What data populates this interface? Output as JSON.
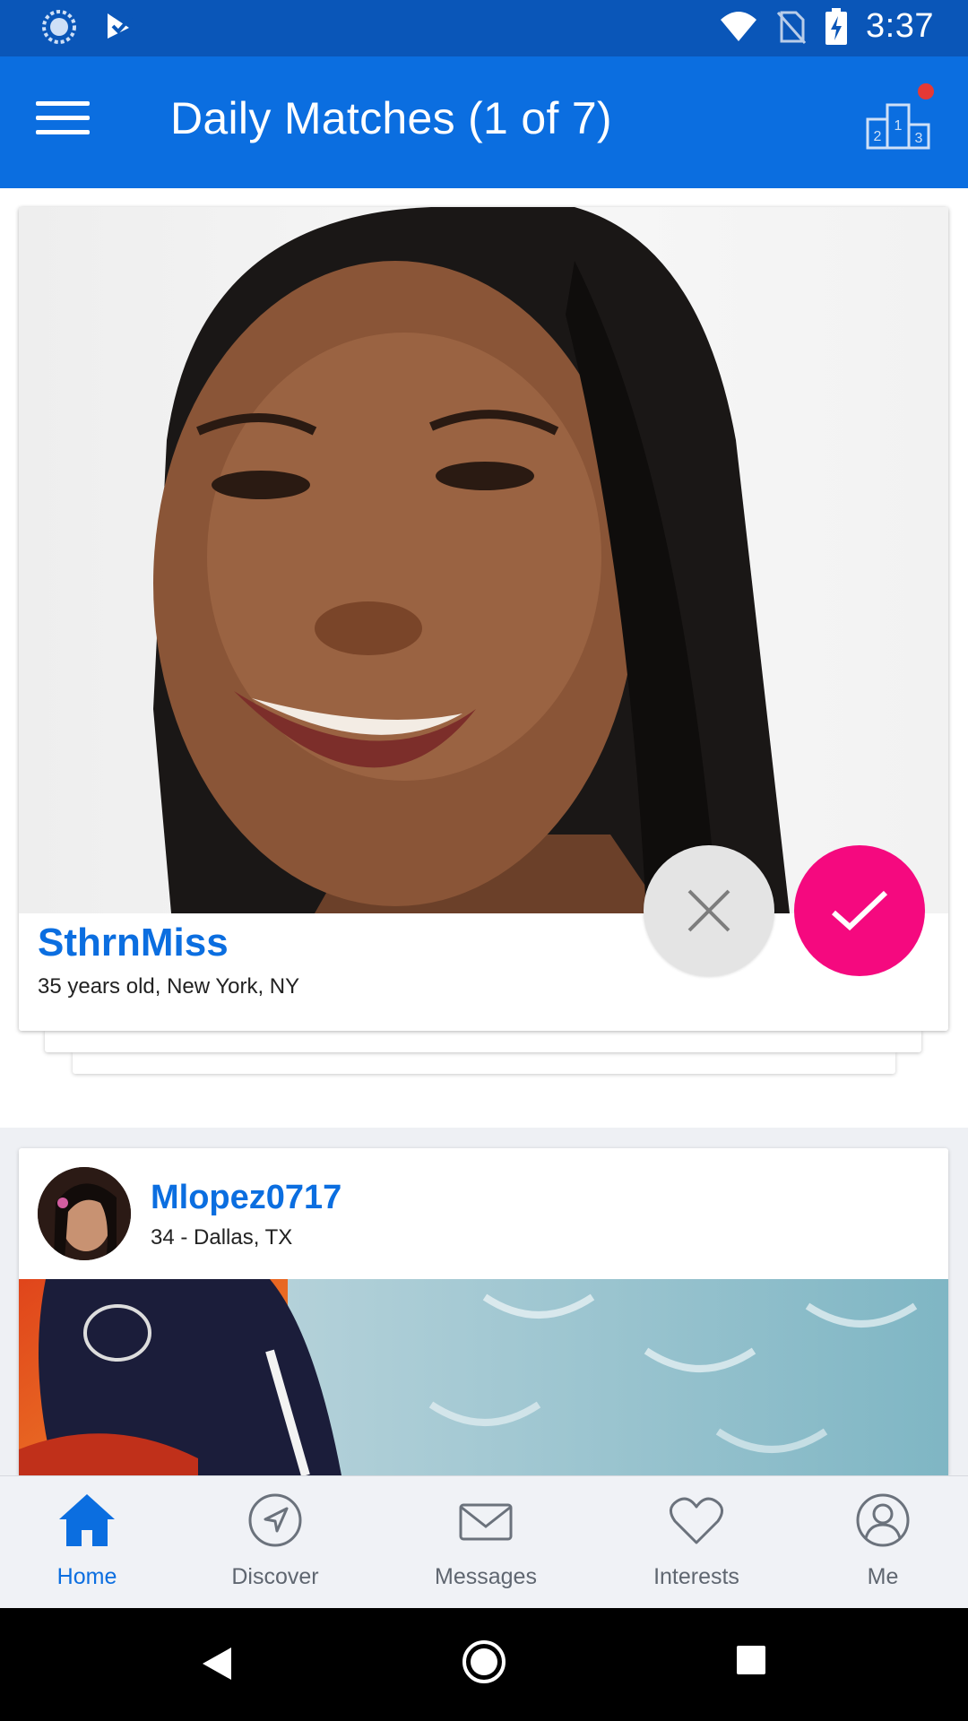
{
  "status_bar": {
    "time": "3:37",
    "left_icons": [
      "sync-icon",
      "download-check-icon"
    ],
    "right_icons": [
      "wifi-icon",
      "no-sim-icon",
      "battery-charging-icon"
    ]
  },
  "app_bar": {
    "title": "Daily Matches (1 of 7)",
    "menu_icon": "hamburger-menu-icon",
    "action_icon": "podium-icon",
    "has_notification": true
  },
  "match_card": {
    "name": "SthrnMiss",
    "info": "35 years old, New York, NY",
    "pass_icon": "close-icon",
    "like_icon": "check-icon"
  },
  "feed_card": {
    "name": "Mlopez0717",
    "info": "34 - Dallas, TX"
  },
  "bottom_nav": {
    "items": [
      {
        "label": "Home",
        "icon": "home-icon",
        "active": true
      },
      {
        "label": "Discover",
        "icon": "compass-icon",
        "active": false
      },
      {
        "label": "Messages",
        "icon": "envelope-icon",
        "active": false
      },
      {
        "label": "Interests",
        "icon": "heart-icon",
        "active": false
      },
      {
        "label": "Me",
        "icon": "person-icon",
        "active": false
      }
    ]
  },
  "colors": {
    "primary": "#0b6ee0",
    "status_bar": "#0a56b8",
    "like": "#f5097f",
    "pass": "#e4e4e4"
  }
}
